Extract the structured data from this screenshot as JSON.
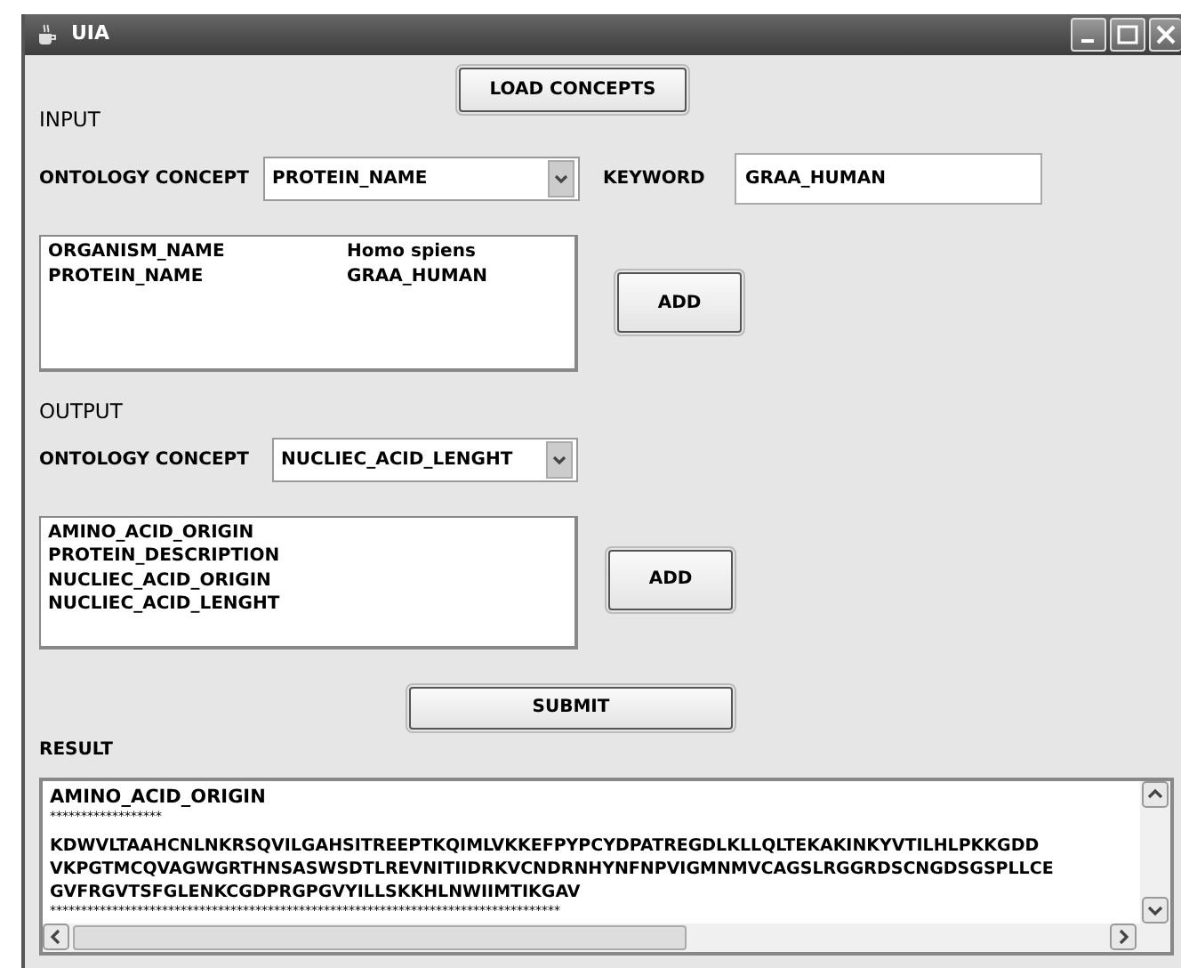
{
  "window": {
    "title": "UIA"
  },
  "load_button": "LOAD CONCEPTS",
  "input": {
    "heading": "INPUT",
    "concept_label": "ONTOLOGY CONCEPT",
    "concept_value": "PROTEIN_NAME",
    "keyword_label": "KEYWORD",
    "keyword_value": "GRAA_HUMAN",
    "rows": [
      {
        "name": "ORGANISM_NAME",
        "value": "Homo spiens"
      },
      {
        "name": "PROTEIN_NAME",
        "value": "GRAA_HUMAN"
      }
    ],
    "add_button": "ADD"
  },
  "output": {
    "heading": "OUTPUT",
    "concept_label": "ONTOLOGY CONCEPT",
    "concept_value": "NUCLIEC_ACID_LENGHT",
    "items": [
      "AMINO_ACID_ORIGIN",
      "PROTEIN_DESCRIPTION",
      "NUCLIEC_ACID_ORIGIN",
      "NUCLIEC_ACID_LENGHT"
    ],
    "add_button": "ADD"
  },
  "submit_button": "SUBMIT",
  "result": {
    "heading": "RESULT",
    "lines": [
      {
        "kind": "title",
        "text": "AMINO_ACID_ORIGIN"
      },
      {
        "kind": "rule",
        "text": "******************"
      },
      {
        "kind": "sequence",
        "text": "KDWVLTAAHCNLNKRSQVILGAHSITREEPTKQIMLVKKEFPYPCYDPATREGDLKLLQLTEKAKINKYVTILHLPKKGDD"
      },
      {
        "kind": "sequence",
        "text": "VKPGTMCQVAGWGRTHNSASWSDTLREVNITIIDRKVCNDRNHYNFNPVIGMNMVCAGSLRGGRDSCNGDSGSPLLCE"
      },
      {
        "kind": "sequence",
        "text": "GVFRGVTSFGLENKCGDPRGPGVYILLSKKHLNWIIMTIKGAV"
      },
      {
        "kind": "rule",
        "text": "**********************************************************************************"
      }
    ]
  }
}
